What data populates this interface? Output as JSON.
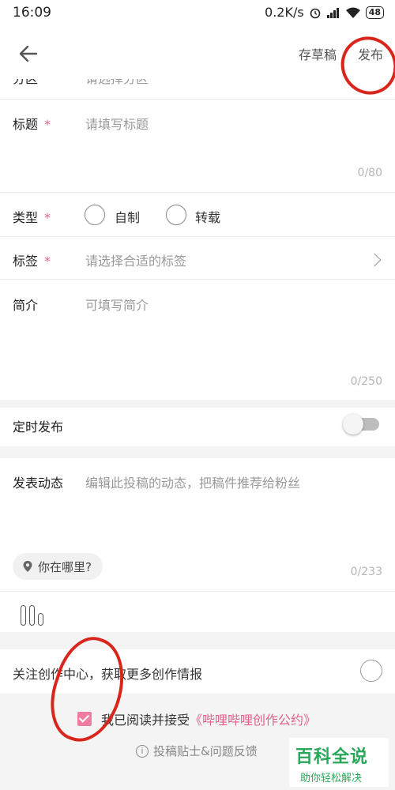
{
  "status_bar": {
    "time": "16:09",
    "speed": "0.2K/s",
    "battery": "48"
  },
  "app_bar": {
    "draft_label": "存草稿",
    "publish_label": "发布"
  },
  "form": {
    "partition_label": "分区",
    "partition_placeholder": "请选择分区",
    "title_label": "标题",
    "required_mark": "*",
    "title_placeholder": "请填写标题",
    "title_counter": "0/80",
    "type_label": "类型",
    "type_options": [
      "自制",
      "转载"
    ],
    "tags_label": "标签",
    "tags_placeholder": "请选择合适的标签",
    "intro_label": "简介",
    "intro_placeholder": "可填写简介",
    "intro_counter": "0/250",
    "schedule_label": "定时发布",
    "post_label": "发表动态",
    "post_placeholder": "编辑此投稿的动态，把稿件推荐给粉丝",
    "location_label": "你在哪里?",
    "post_counter": "0/233"
  },
  "follow": {
    "text": "关注创作中心，获取更多创作情报"
  },
  "agreement": {
    "text": "我已阅读并接受",
    "link": "《哔哩哔哩创作公约》"
  },
  "tips": {
    "text": "投稿贴士&问题反馈"
  },
  "watermark": {
    "title": "百科全说",
    "subtitle": "助你轻松解决"
  },
  "colors": {
    "accent_pink": "#e0628a",
    "annotation_red": "#d9261c",
    "watermark_green": "#2aa85a"
  }
}
